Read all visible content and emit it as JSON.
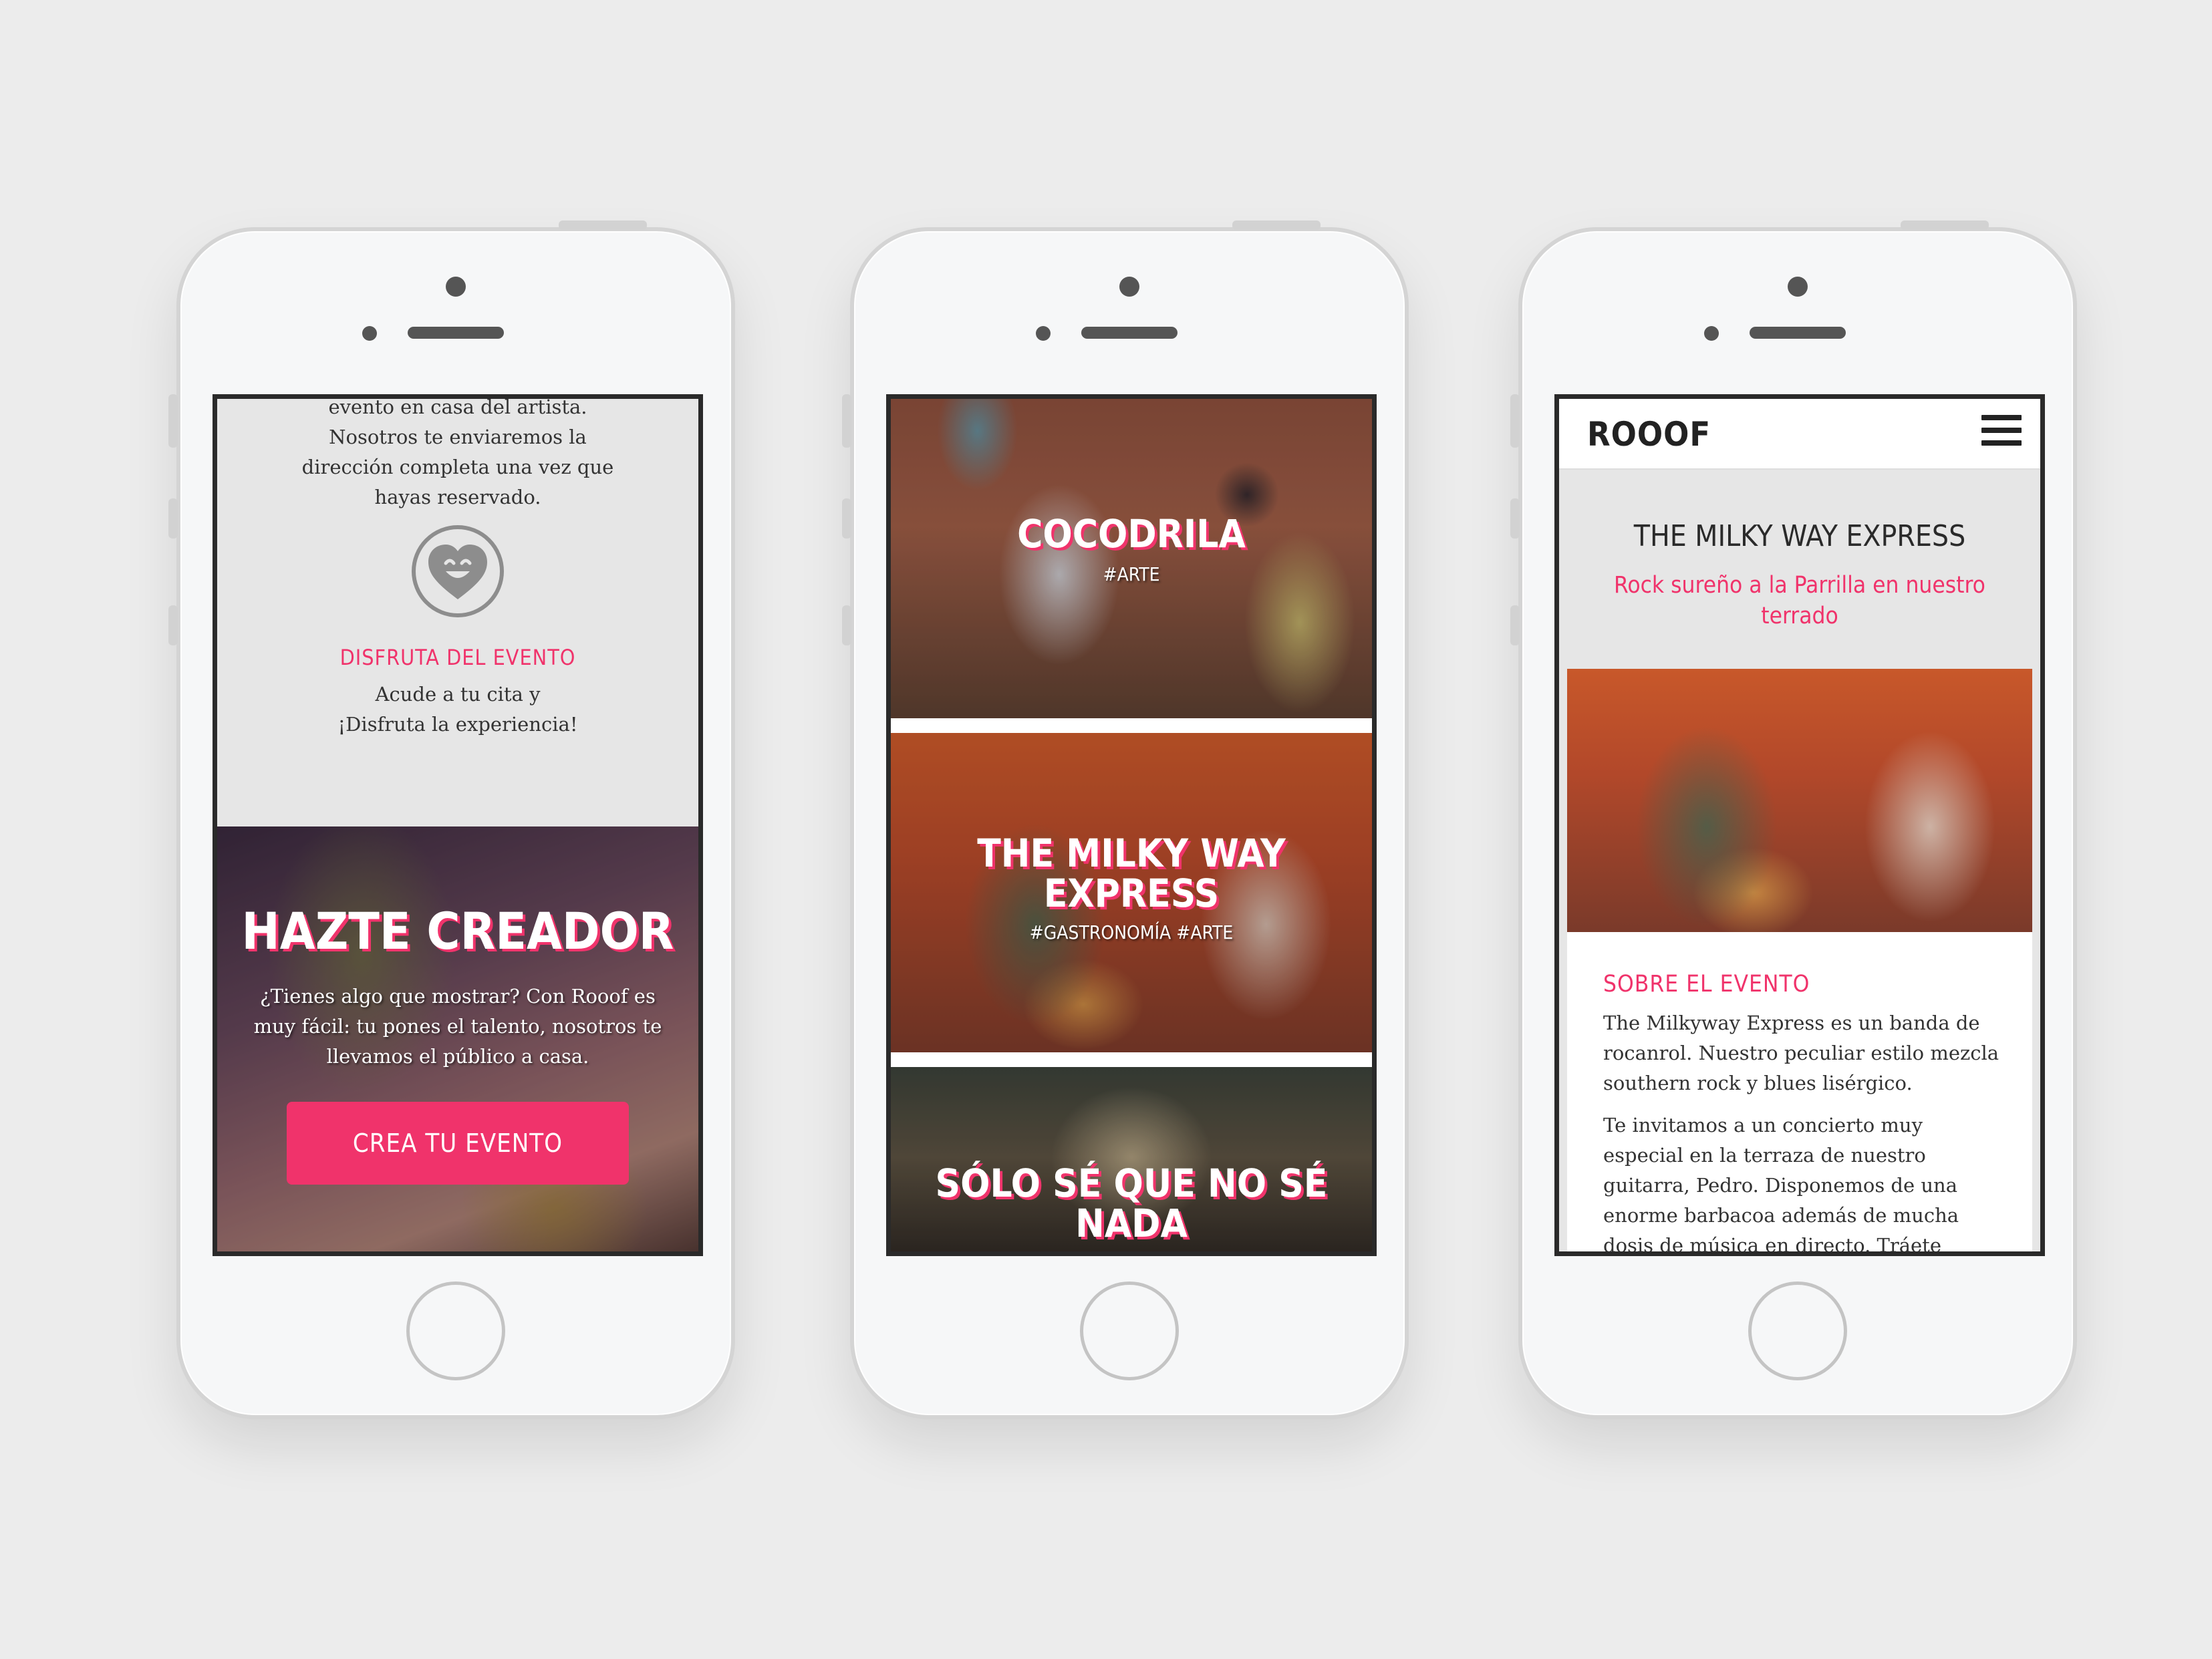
{
  "phone1": {
    "intro_lines": [
      "evento en casa del artista.",
      "Nosotros te enviaremos la",
      "dirección completa una vez que",
      "hayas reservado."
    ],
    "step_title": "DISFRUTA DEL EVENTO",
    "step_desc_lines": [
      "Acude a tu cita y",
      "¡Disfruta la experiencia!"
    ],
    "hero_title": "HAZTE CREADOR",
    "hero_text": "¿Tienes algo que mostrar? Con Rooof es muy fácil: tu pones el talento, nosotros te llevamos el público a casa.",
    "cta_label": "CREA TU EVENTO",
    "icon": "heart-smile-icon"
  },
  "phone2": {
    "events": [
      {
        "title": "COCODRILA",
        "tags": "#ARTE"
      },
      {
        "title": "THE MILKY WAY EXPRESS",
        "tags": "#GASTRONOMÍA #ARTE"
      },
      {
        "title": "SÓLO SÉ QUE NO SÉ NADA",
        "tags": ""
      }
    ]
  },
  "phone3": {
    "logo": "ROOOF",
    "menu_icon": "hamburger-menu-icon",
    "event_title": "THE MILKY WAY EXPRESS",
    "event_subtitle": "Rock sureño a la Parrilla en nuestro terrado",
    "section_title": "SOBRE EL EVENTO",
    "paragraph1": "The Milkyway Express es un banda de rocanrol. Nuestro peculiar estilo mezcla southern rock y blues lisérgico.",
    "paragraph2": "Te invitamos a un concierto muy especial en la terraza de nuestro guitarra, Pedro. Disponemos de una enorme barbacoa además de mucha dosis de música en directo. Tráete comida y bebida para"
  },
  "colors": {
    "accent": "#f0336b",
    "background": "#ececec",
    "text": "#333333"
  }
}
